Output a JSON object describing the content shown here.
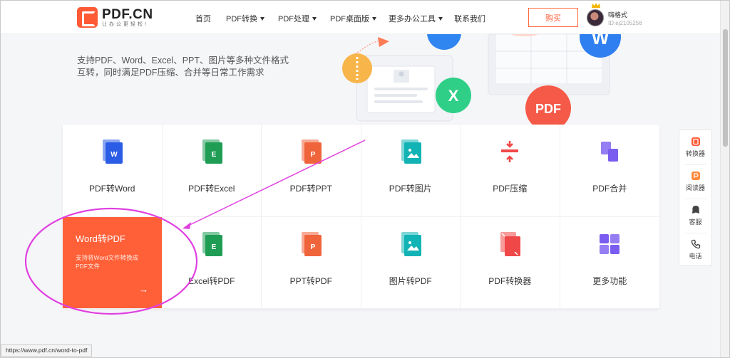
{
  "header": {
    "logo_title": "PDF.CN",
    "logo_sub": "让办公更轻松!",
    "nav": [
      {
        "label": "首页",
        "dropdown": false
      },
      {
        "label": "PDF转换",
        "dropdown": true
      },
      {
        "label": "PDF处理",
        "dropdown": true
      },
      {
        "label": "PDF桌面版",
        "dropdown": true
      },
      {
        "label": "更多办公工具",
        "dropdown": true
      },
      {
        "label": "联系我们",
        "dropdown": false
      }
    ],
    "buy_label": "购买",
    "user": {
      "name": "嗨格式",
      "id": "ID:ej2105256"
    }
  },
  "hero": {
    "line1": "支持PDF、Word、Excel、PPT、图片等多种文件格式",
    "line2": "互转，同时满足PDF压缩、合并等日常工作需求",
    "art_labels": {
      "excel": "X",
      "word": "W",
      "pdf": "PDF"
    }
  },
  "tools": [
    {
      "label": "PDF转Word",
      "icon": "word-doc-icon",
      "color": "#2b5ce6"
    },
    {
      "label": "PDF转Excel",
      "icon": "excel-doc-icon",
      "color": "#1f9d55"
    },
    {
      "label": "PDF转PPT",
      "icon": "ppt-doc-icon",
      "color": "#f0643c"
    },
    {
      "label": "PDF转图片",
      "icon": "image-doc-icon",
      "color": "#12b3b5"
    },
    {
      "label": "PDF压缩",
      "icon": "compress-icon",
      "color": "#f04848"
    },
    {
      "label": "PDF合并",
      "icon": "merge-icon",
      "color": "#7a5cf0"
    },
    {
      "label": "Word转PDF",
      "icon": "word-doc-icon",
      "color": "#2b5ce6",
      "active": true,
      "desc": "支持将Word文件转换成PDF文件",
      "arrow": "→"
    },
    {
      "label": "Excel转PDF",
      "icon": "excel-doc-icon",
      "color": "#1f9d55"
    },
    {
      "label": "PPT转PDF",
      "icon": "ppt-doc-icon",
      "color": "#f0643c"
    },
    {
      "label": "图片转PDF",
      "icon": "image-doc-icon",
      "color": "#12b3b5"
    },
    {
      "label": "PDF转换器",
      "icon": "converter-icon",
      "color": "#f04848"
    },
    {
      "label": "更多功能",
      "icon": "grid-icon",
      "color": "#7a5cf0"
    }
  ],
  "side": [
    {
      "label": "转换器",
      "icon": "converter-icon"
    },
    {
      "label": "阅读器",
      "icon": "reader-icon"
    },
    {
      "label": "客服",
      "icon": "customer-service-icon"
    },
    {
      "label": "电话",
      "icon": "phone-icon"
    }
  ],
  "status_url": "https://www.pdf.cn/word-to-pdf",
  "doc_letters": {
    "word": "W",
    "excel": "E",
    "ppt": "P"
  }
}
